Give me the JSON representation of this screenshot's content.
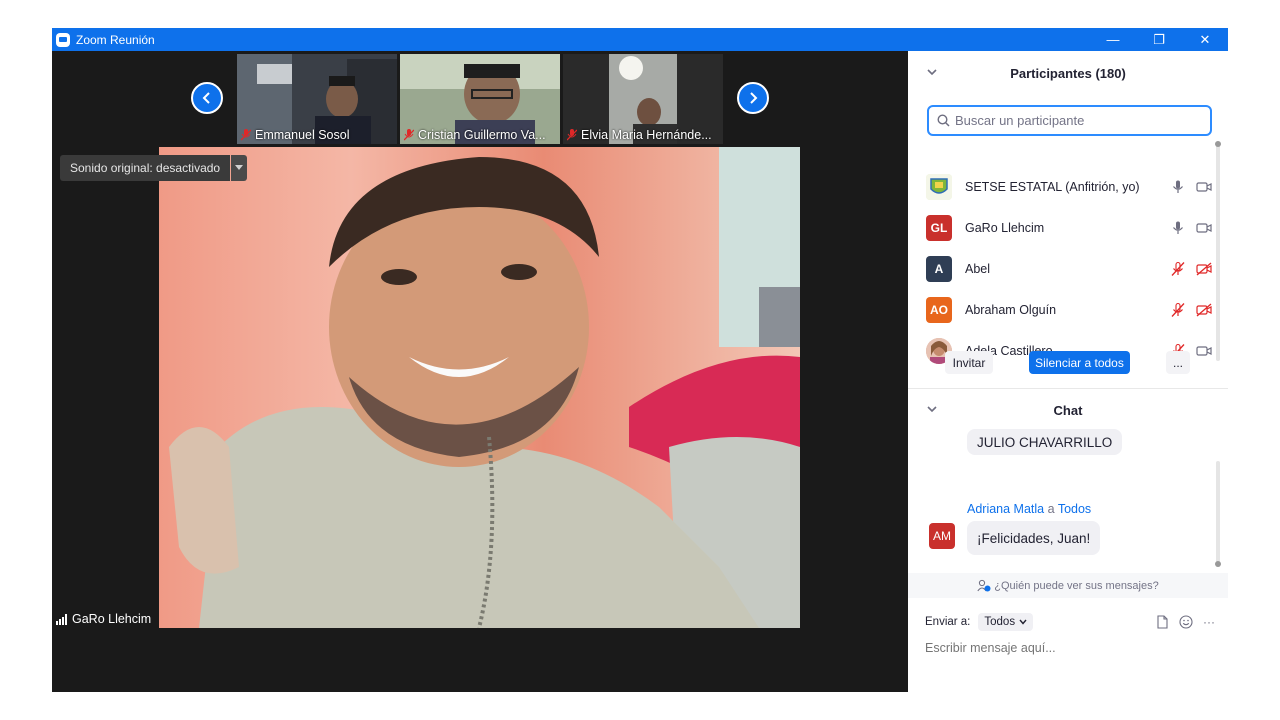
{
  "window": {
    "title": "Zoom Reunión",
    "minimize": "—",
    "restore": "❐",
    "close": "✕"
  },
  "thumbnails": [
    {
      "name": "Emmanuel Sosol",
      "muted": true
    },
    {
      "name": "Cristian Guillermo Va...",
      "muted": true
    },
    {
      "name": "Elvia Maria Hernánde...",
      "muted": true
    }
  ],
  "sound_tooltip": {
    "label": "Sonido original: desactivado"
  },
  "active_speaker": {
    "name": "GaRo Llehcim"
  },
  "participants_panel": {
    "title": "Participantes (180)",
    "search_placeholder": "Buscar un participante",
    "participants": [
      {
        "name": "SETSE ESTATAL (Anfitrión, yo)",
        "initials": "",
        "color": "#e9f0c8",
        "mic": "on",
        "video": "on"
      },
      {
        "name": "GaRo Llehcim",
        "initials": "GL",
        "color": "#c9302c",
        "mic": "on",
        "video": "on"
      },
      {
        "name": "Abel",
        "initials": "A",
        "color": "#2f3e55",
        "mic": "off",
        "video": "off"
      },
      {
        "name": "Abraham Olguín",
        "initials": "AO",
        "color": "#e8661c",
        "mic": "off",
        "video": "off"
      },
      {
        "name": "Adela Castillero",
        "initials": "",
        "color": "#d7a08a",
        "mic": "off",
        "video": "on"
      }
    ],
    "invite_label": "Invitar",
    "mute_all_label": "Silenciar a todos",
    "more_label": "..."
  },
  "chat_panel": {
    "title": "Chat",
    "messages": [
      {
        "sender": "",
        "to": "",
        "text": "JULIO CHAVARRILLO"
      },
      {
        "sender": "Adriana Matla",
        "connector": "a",
        "to": "Todos",
        "initials": "AM",
        "text": "¡Felicidades, Juan!"
      }
    ],
    "privacy_text": "¿Quién puede ver sus mensajes?",
    "send_to_label": "Enviar a:",
    "send_to_value": "Todos",
    "compose_placeholder": "Escribir mensaje aquí...",
    "more_label": "···"
  },
  "colors": {
    "titlebar": "#0e71eb",
    "accent": "#0e71eb",
    "muted_red": "#e02828",
    "video_bg": "#1a1a1a"
  }
}
